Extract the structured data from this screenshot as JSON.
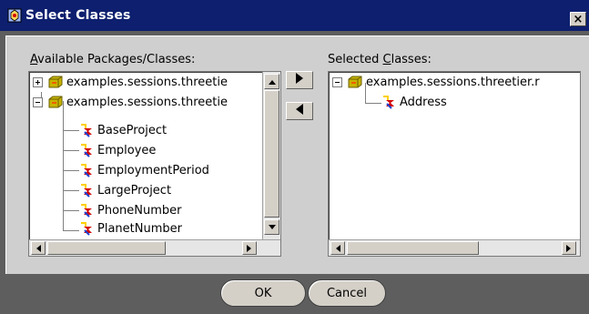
{
  "window": {
    "title": "Select Classes",
    "close_label": "×"
  },
  "available": {
    "label_accel": "A",
    "label_rest": "vailable Packages/Classes:",
    "items": [
      {
        "label": "examples.sessions.threetie",
        "kind": "package",
        "expanded": false
      },
      {
        "label": "examples.sessions.threetie",
        "kind": "package",
        "expanded": true
      },
      {
        "label": "BaseProject",
        "kind": "class"
      },
      {
        "label": "Employee",
        "kind": "class"
      },
      {
        "label": "EmploymentPeriod",
        "kind": "class"
      },
      {
        "label": "LargeProject",
        "kind": "class"
      },
      {
        "label": "PhoneNumber",
        "kind": "class"
      },
      {
        "label": "PlanetNumber",
        "kind": "class"
      }
    ]
  },
  "selected": {
    "label_rest_before": "Selected ",
    "label_accel": "C",
    "label_rest": "lasses:",
    "items": [
      {
        "label": "examples.sessions.threetier.r",
        "kind": "package",
        "expanded": true
      },
      {
        "label": "Address",
        "kind": "class"
      }
    ]
  },
  "buttons": {
    "ok": "OK",
    "cancel": "Cancel"
  },
  "colors": {
    "title_bar": "#0d1f6e",
    "dialog_bg": "#cfcfcf",
    "package_icon": "#c8b400",
    "class_icon_red": "#d40000",
    "class_icon_blue": "#1c3fd0"
  },
  "icons": {
    "title": "app-icon",
    "package": "package-icon",
    "class": "class-icon",
    "add": "right-arrow-icon",
    "remove": "left-arrow-icon"
  }
}
